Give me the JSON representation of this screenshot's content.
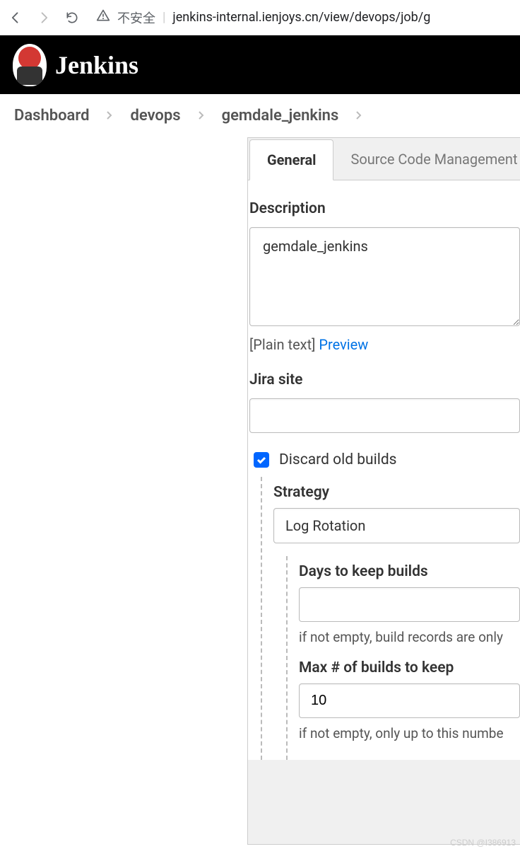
{
  "browser": {
    "insecure_label": "不安全",
    "url": "jenkins-internal.ienjoys.cn/view/devops/job/g"
  },
  "header": {
    "product_name": "Jenkins"
  },
  "breadcrumbs": {
    "items": [
      "Dashboard",
      "devops",
      "gemdale_jenkins"
    ]
  },
  "tabs": {
    "items": [
      {
        "label": "General",
        "active": true
      },
      {
        "label": "Source Code Management",
        "active": false
      }
    ]
  },
  "form": {
    "description": {
      "label": "Description",
      "value": "gemdale_jenkins",
      "mode_label": "[Plain text]",
      "preview_label": "Preview"
    },
    "jira": {
      "label": "Jira site",
      "value": ""
    },
    "discard": {
      "checked": true,
      "label": "Discard old builds",
      "strategy": {
        "label": "Strategy",
        "value": "Log Rotation"
      },
      "days": {
        "label": "Days to keep builds",
        "value": "",
        "helper": "if not empty, build records are only"
      },
      "max": {
        "label": "Max # of builds to keep",
        "value": "10",
        "helper": "if not empty, only up to this numbe"
      }
    }
  },
  "watermark": "CSDN @I386913"
}
